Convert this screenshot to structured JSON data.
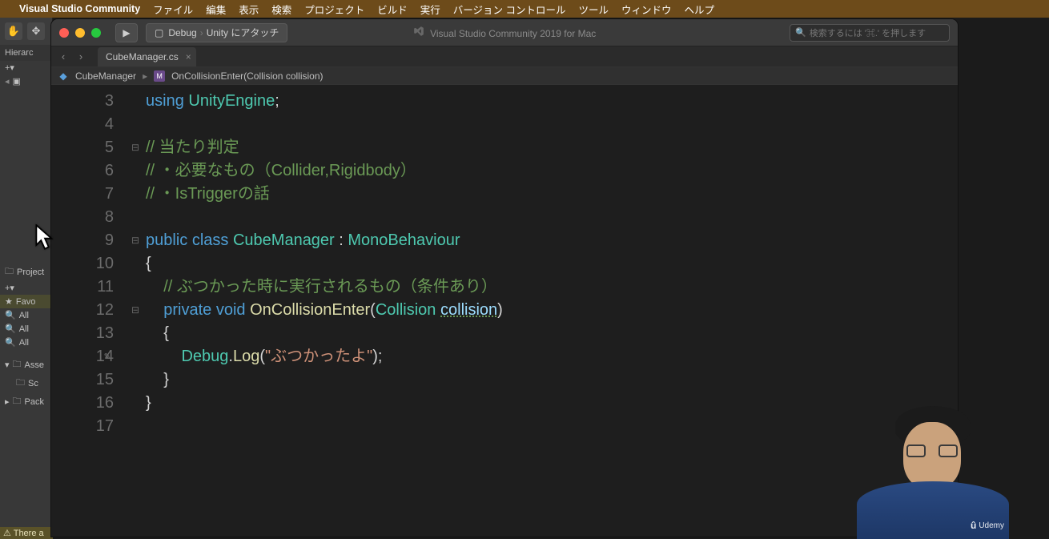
{
  "menubar": {
    "app_title": "Visual Studio Community",
    "items": [
      "ファイル",
      "編集",
      "表示",
      "検索",
      "プロジェクト",
      "ビルド",
      "実行",
      "バージョン コントロール",
      "ツール",
      "ウィンドウ",
      "ヘルプ"
    ]
  },
  "toolbar": {
    "run_icon": "▶",
    "config_icon": "▢",
    "config_label": "Debug",
    "target_label": "Unity にアタッチ",
    "window_title": "Visual Studio Community 2019 for Mac",
    "search_icon": "⍟",
    "search_placeholder": "検索するには '⌘.' を押します"
  },
  "tabs": {
    "back": "‹",
    "forward": "›",
    "file_name": "CubeManager.cs",
    "close": "×"
  },
  "breadcrumb": {
    "class_icon": "◆",
    "class_name": "CubeManager",
    "sep": "▸",
    "method_icon": "M",
    "method_sig": "OnCollisionEnter(Collision collision)"
  },
  "code": {
    "lines": [
      {
        "num": "3",
        "t": [
          [
            "kw",
            "using"
          ],
          [
            "punc",
            " "
          ],
          [
            "type",
            "UnityEngine"
          ],
          [
            "punc",
            ";"
          ]
        ]
      },
      {
        "num": "4",
        "t": []
      },
      {
        "num": "5",
        "fold": "-",
        "t": [
          [
            "cmt",
            "// 当たり判定"
          ]
        ]
      },
      {
        "num": "6",
        "t": [
          [
            "cmt",
            "// ・必要なもの（Collider,Rigidbody）"
          ]
        ]
      },
      {
        "num": "7",
        "t": [
          [
            "cmt",
            "// ・IsTriggerの話"
          ]
        ]
      },
      {
        "num": "8",
        "t": []
      },
      {
        "num": "9",
        "fold": "-",
        "t": [
          [
            "kw",
            "public"
          ],
          [
            "punc",
            " "
          ],
          [
            "kw",
            "class"
          ],
          [
            "punc",
            " "
          ],
          [
            "type",
            "CubeManager"
          ],
          [
            "punc",
            " : "
          ],
          [
            "type",
            "MonoBehaviour"
          ]
        ]
      },
      {
        "num": "10",
        "t": [
          [
            "punc",
            "{"
          ]
        ]
      },
      {
        "num": "11",
        "t": [
          [
            "punc",
            "    "
          ],
          [
            "cmt",
            "// ぶつかった時に実行されるもの（条件あり）"
          ]
        ]
      },
      {
        "num": "12",
        "fold": "-",
        "t": [
          [
            "punc",
            "    "
          ],
          [
            "kw",
            "private"
          ],
          [
            "punc",
            " "
          ],
          [
            "kw",
            "void"
          ],
          [
            "punc",
            " "
          ],
          [
            "method",
            "OnCollisionEnter"
          ],
          [
            "punc",
            "("
          ],
          [
            "type",
            "Collision"
          ],
          [
            "punc",
            " "
          ],
          [
            "param",
            "collision"
          ],
          [
            "punc",
            ")"
          ]
        ]
      },
      {
        "num": "13",
        "t": [
          [
            "punc",
            "    {"
          ]
        ]
      },
      {
        "num": "14",
        "marker": "✎",
        "t": [
          [
            "punc",
            "        "
          ],
          [
            "type",
            "Debug"
          ],
          [
            "punc",
            "."
          ],
          [
            "method",
            "Log"
          ],
          [
            "punc",
            "("
          ],
          [
            "str",
            "\"ぶつかったよ\""
          ],
          [
            "punc",
            ");"
          ]
        ]
      },
      {
        "num": "15",
        "t": [
          [
            "punc",
            "    }"
          ]
        ]
      },
      {
        "num": "16",
        "t": [
          [
            "punc",
            "}"
          ]
        ]
      },
      {
        "num": "17",
        "t": []
      }
    ]
  },
  "unity": {
    "hand_icon": "✋",
    "move_icon": "✥",
    "hierarchy_label": "Hierarc",
    "plus": "+▾",
    "collapse": "◂",
    "cube_icon": "▣",
    "project_label": "Project",
    "fav_label": "Favo",
    "all_label": "All",
    "assets_label": "Asse",
    "scripts_label": "Sc",
    "packages_label": "Pack",
    "warn_label": "There a"
  },
  "webcam": {
    "badge_text": "Udemy"
  }
}
